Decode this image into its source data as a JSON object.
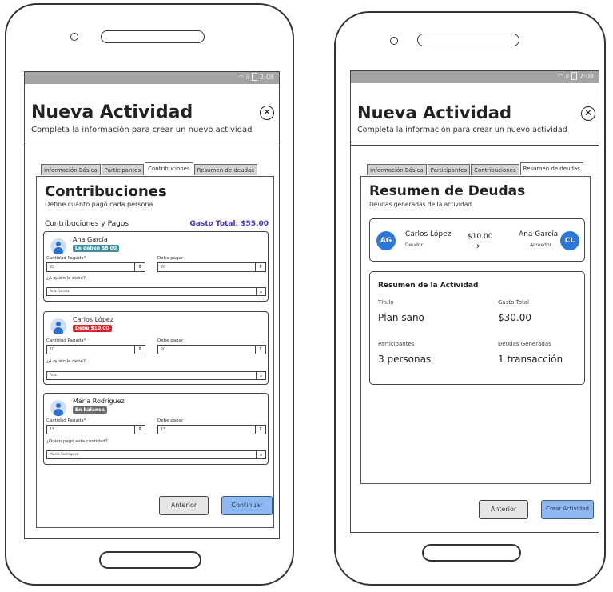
{
  "status": {
    "time": "2:08"
  },
  "left_screen": {
    "title": "Nueva Actividad",
    "subtitle": "Completa la información para crear un nuevo actividad",
    "tabs": [
      "Información Básica",
      "Participantes",
      "Contribuciones",
      "Resumen de deudas"
    ],
    "active_tab": "Contribuciones",
    "section_title": "Contribuciones",
    "section_subtitle": "Define cuánto pagó cada persona",
    "list_title": "Contribuciones y Pagos",
    "total_label": "Gasto Total: $55.00",
    "participants": [
      {
        "name": "Ana García",
        "badge": "Le deben $8.00",
        "badge_color": "#3f8fa0",
        "paid_label": "Cantidad Pagada*",
        "paid_value": "20",
        "owe_label": "Debe pagar",
        "owe_value": "20",
        "who_label": "¿A quién le debe?",
        "who_value": "Ana García"
      },
      {
        "name": "Carlos López",
        "badge": "Debe $10.00",
        "badge_color": "#d9222a",
        "paid_label": "Cantidad Pagada*",
        "paid_value": "10",
        "owe_label": "Debe pagar",
        "owe_value": "20",
        "who_label": "¿A quién le debe?",
        "who_value": "Ana"
      },
      {
        "name": "María Rodríguez",
        "badge": "En balance",
        "badge_color": "#6c6c6c",
        "paid_label": "Cantidad Pagada*",
        "paid_value": "15",
        "owe_label": "Debe pagar",
        "owe_value": "15",
        "who_label": "¿Quién pagó esta cantidad?",
        "who_value": "María Rodríguez"
      }
    ],
    "btn_back": "Anterior",
    "btn_next": "Continuar"
  },
  "right_screen": {
    "title": "Nueva Actividad",
    "subtitle": "Completa la información para crear un nuevo actividad",
    "tabs": [
      "Información Básica",
      "Participantes",
      "Contribuciones",
      "Resumen de deudas"
    ],
    "active_tab": "Resumen de deudas",
    "section_title": "Resumen de Deudas",
    "section_subtitle": "Deudas generadas de la actividad",
    "debt": {
      "from_initials": "AG",
      "from_name": "Carlos López",
      "from_role": "Deudor",
      "amount": "$10.00",
      "arrow": "→",
      "to_name": "Ana García",
      "to_role": "Acreedor",
      "to_initials": "CL"
    },
    "summary": {
      "title": "Resumen de la Actividad",
      "title_label": "Título",
      "title_value": "Plan sano",
      "total_label": "Gasto Total",
      "total_value": "$30.00",
      "participants_label": "Participantes",
      "participants_value": "3 personas",
      "debts_label": "Deudas Generadas",
      "debts_value": "1 transacción"
    },
    "btn_back": "Anterior",
    "btn_create": "Crear Actividad"
  },
  "colors": {
    "accent_blue": "#8db8f2",
    "total_purple": "#4a35c8",
    "avatar_blue": "#2b78d8"
  }
}
